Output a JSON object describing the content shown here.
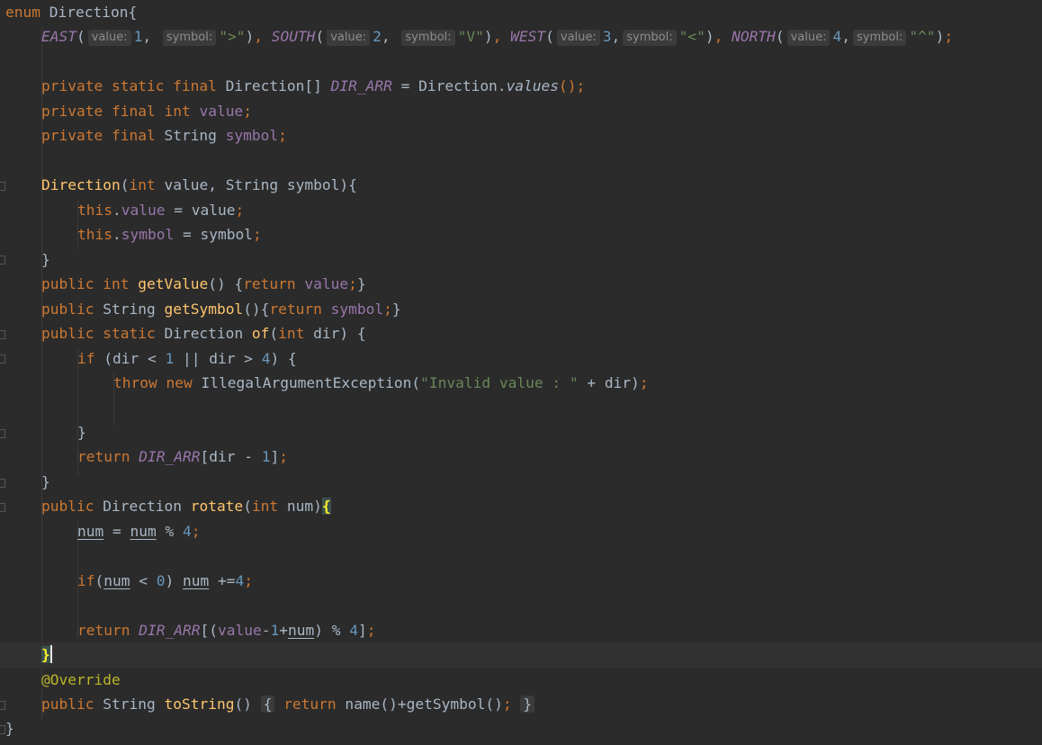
{
  "editor": {
    "enum_decl": {
      "keyword": "enum",
      "name": "Direction",
      "brace": "{"
    },
    "constants": {
      "east": {
        "name": "EAST",
        "hint_value": "value:",
        "value": "1",
        "hint_symbol": "symbol:",
        "symbol": "\">\""
      },
      "south": {
        "name": "SOUTH",
        "hint_value": "value:",
        "value": "2",
        "hint_symbol": "symbol:",
        "symbol": "\"V\""
      },
      "west": {
        "name": "WEST",
        "hint_value": "value:",
        "value": "3",
        "hint_symbol": "symbol:",
        "symbol": "\"<\""
      },
      "north": {
        "name": "NORTH",
        "hint_value": "value:",
        "value": "4",
        "hint_symbol": "symbol:",
        "symbol": "\"^\""
      }
    },
    "field_dirarr": {
      "mods": "private static final",
      "type": "Direction[]",
      "name": "DIR_ARR",
      "eq": " = Direction.",
      "call": "values",
      "end": "();"
    },
    "field_value": {
      "mods": "private final",
      "type_kw": "int",
      "name": "value",
      "semi": ";"
    },
    "field_symbol": {
      "mods": "private final",
      "type": "String",
      "name": "symbol",
      "semi": ";"
    },
    "ctor": {
      "name": "Direction",
      "params_open": "(",
      "p1_type": "int",
      "p1_name": " value, ",
      "p2": "String symbol",
      "params_close": "){",
      "this1_kw": "this",
      "this1_field": "value",
      "this1_rest": " = value",
      "this2_kw": "this",
      "this2_field": "symbol",
      "this2_rest": " = symbol",
      "close": "}"
    },
    "getvalue": {
      "mods": "public",
      "type_kw": "int",
      "name": "getValue",
      "mid": "() {",
      "ret": "return",
      "field": "value",
      "end": "}"
    },
    "getsymbol": {
      "mods": "public",
      "type": "String",
      "name": "getSymbol",
      "mid": "(){",
      "ret": "return",
      "field": "symbol",
      "end": "}"
    },
    "of": {
      "mods": "public static",
      "type": "Direction",
      "name": "of",
      "p_open": "(",
      "p_type": "int",
      "p_rest": " dir) {",
      "if_kw": "if",
      "if_a": " (dir < ",
      "n1": "1",
      "if_b": " || dir > ",
      "n4": "4",
      "if_c": ") {",
      "throw_kw": "throw",
      "new_kw": "new",
      "ex": "IllegalArgumentException(",
      "msg": "\"Invalid value : \"",
      "ex_end": " + dir)",
      "if_close": "}",
      "ret_kw": "return",
      "arr": "DIR_ARR",
      "ret_a": "[dir - ",
      "ret_n": "1",
      "ret_b": "]",
      "close": "}"
    },
    "rotate": {
      "mods": "public",
      "type": "Direction",
      "name": "rotate",
      "p_open": "(",
      "p_type": "int",
      "p_rest": " num)",
      "brace": "{",
      "s1_a": "num",
      "s1_b": " = ",
      "s1_c": "num",
      "s1_d": " % ",
      "s1_n": "4",
      "if_kw": "if",
      "if_a": "(",
      "if_num": "num",
      "if_b": " < ",
      "if_zero": "0",
      "if_c": ") ",
      "if_num2": "num",
      "if_d": " +=",
      "if_n": "4",
      "ret_kw": "return",
      "arr": "DIR_ARR",
      "ret_a": "[(",
      "ret_field": "value",
      "ret_b": "-",
      "ret_one": "1",
      "ret_c": "+",
      "ret_num": "num",
      "ret_d": ") % ",
      "ret_four": "4",
      "ret_e": "]",
      "close": "}"
    },
    "override": "@Override",
    "tostring": {
      "mods": "public",
      "type": "String",
      "name": "toString",
      "paren": "()",
      "ob": "{",
      "ret": "return",
      "body": " name()+getSymbol()",
      "cb": "}"
    },
    "final_close": "}",
    "punct": {
      "comma": ",",
      "semi": ";",
      "paren_open": "(",
      "paren_close": ")",
      "dot": "."
    }
  }
}
